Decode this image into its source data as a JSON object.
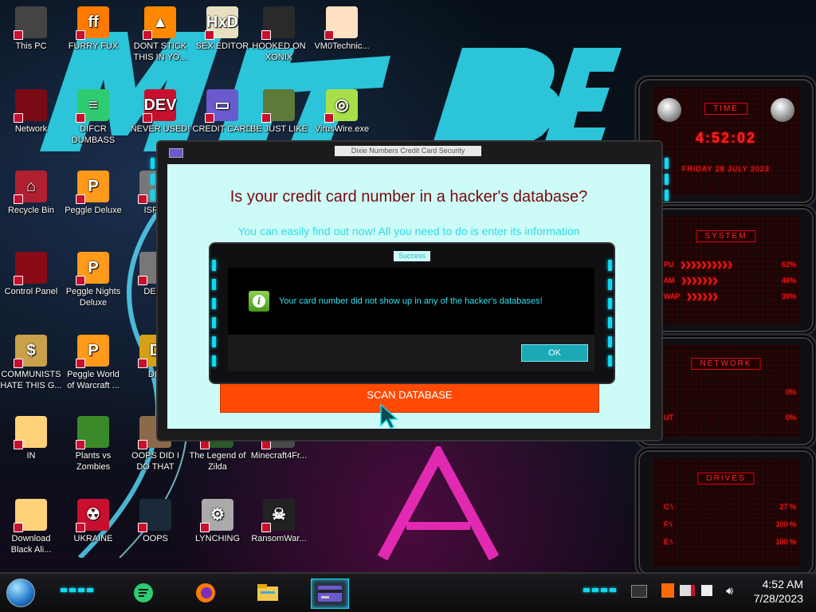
{
  "desktop_icons": [
    {
      "label": "This PC",
      "name": "this-pc",
      "color": "#444"
    },
    {
      "label": "FURRY FUX",
      "name": "firefox",
      "color": "#ff7b00"
    },
    {
      "label": "DONT STICK THIS IN YO...",
      "name": "vlc",
      "color": "#ff8800"
    },
    {
      "label": "SEX EDITOR",
      "name": "hxd",
      "color": "#e8e0c0"
    },
    {
      "label": "HOOKED ON XONIX",
      "name": "xonix",
      "color": "#2a2a2a"
    },
    {
      "label": "VM0Technic...",
      "name": "vm0",
      "color": "#ffe0c0"
    },
    {
      "label": "Network",
      "name": "network",
      "color": "#7a0a14"
    },
    {
      "label": "DIFCR DUMBASS",
      "name": "discord",
      "color": "#2ecc71"
    },
    {
      "label": "NEVER USED!",
      "name": "devcpp",
      "color": "#c8102e"
    },
    {
      "label": "CREDIT CARD",
      "name": "credit-card",
      "color": "#6a5acd"
    },
    {
      "label": "BE JUST LIKE",
      "name": "be-just-like",
      "color": "#5c7a3a"
    },
    {
      "label": "VirusWire.exe",
      "name": "viruswire",
      "color": "#a8e04a"
    },
    {
      "label": "Recycle Bin",
      "name": "recycle-bin",
      "color": "#b02030"
    },
    {
      "label": "Peggle Deluxe",
      "name": "peggle-deluxe",
      "color": "#ff9a1a"
    },
    {
      "label": "ISRAI",
      "name": "israi",
      "color": "#777"
    },
    {
      "label": "Control Panel",
      "name": "control-panel",
      "color": "#8a0a18"
    },
    {
      "label": "Peggle Nights Deluxe",
      "name": "peggle-nights",
      "color": "#ff9a1a"
    },
    {
      "label": "DEEZ",
      "name": "deez",
      "color": "#777"
    },
    {
      "label": "COMMUNISTS HATE THIS G...",
      "name": "communists",
      "color": "#c9a14a"
    },
    {
      "label": "Peggle World of Warcraft ...",
      "name": "peggle-wow",
      "color": "#ff9a1a"
    },
    {
      "label": "DIE",
      "name": "die",
      "color": "#d4a017"
    },
    {
      "label": "IN",
      "name": "in",
      "color": "#ffd27a"
    },
    {
      "label": "Plants vs Zombies",
      "name": "pvz",
      "color": "#3a8a2a"
    },
    {
      "label": "OOPS DID I DO THAT",
      "name": "oops-did-i",
      "color": "#8a6a4a"
    },
    {
      "label": "The Legend of Zilda",
      "name": "zilda",
      "color": "#2a5a2a"
    },
    {
      "label": "Minecraft4Fr...",
      "name": "minecraft",
      "color": "#4a4a4a"
    },
    {
      "label": "Download Black Ali...",
      "name": "download-black-ali",
      "color": "#ffd27a"
    },
    {
      "label": "UKRAINE",
      "name": "ukraine",
      "color": "#c8102e"
    },
    {
      "label": "OOPS",
      "name": "oops",
      "color": "#1a2a3a"
    },
    {
      "label": "LYNCHING",
      "name": "lynching",
      "color": "#aaa"
    },
    {
      "label": "RansomWar...",
      "name": "ransomware",
      "color": "#222"
    }
  ],
  "gadgets": {
    "time": {
      "title": "TIME",
      "clock": "4:52:02",
      "date": "FRIDAY 28 JULY 2023"
    },
    "system": {
      "title": "SYSTEM",
      "rows": [
        {
          "label": "PU",
          "value": "62%"
        },
        {
          "label": "AM",
          "value": "46%"
        },
        {
          "label": "WAP",
          "value": "39%"
        }
      ]
    },
    "network": {
      "title": "NETWORK",
      "rows": [
        {
          "label": "",
          "value": "0%"
        },
        {
          "label": "UT",
          "value": "0%"
        }
      ]
    },
    "drives": {
      "title": "DRIVES",
      "rows": [
        {
          "label": "C:\\",
          "value": "27 %"
        },
        {
          "label": "F:\\",
          "value": "100 %"
        },
        {
          "label": "E:\\",
          "value": "100 %"
        }
      ]
    }
  },
  "window": {
    "title": "Dixie Numbers Credit Card Security",
    "heading": "Is your credit card number in a hacker's database?",
    "subtitle": "You can easily find out now! All you need to do is enter its information",
    "scan_button": "SCAN DATABASE"
  },
  "dialog": {
    "title": "Success",
    "message": "Your card number did not show up in any of the hacker's databases!",
    "ok_button": "OK"
  },
  "taskbar": {
    "pinned": [
      "discord-icon",
      "firefox-icon",
      "file-explorer-icon",
      "credit-card-app-icon"
    ],
    "time": "4:52 AM",
    "date": "7/28/2023"
  },
  "colors": {
    "accent_cyan": "#10d8f0",
    "heading_red": "#7a0a0a",
    "scan_orange": "#ff4a05",
    "gadget_red": "#ff2020",
    "client_bg": "#cdfcf8"
  }
}
